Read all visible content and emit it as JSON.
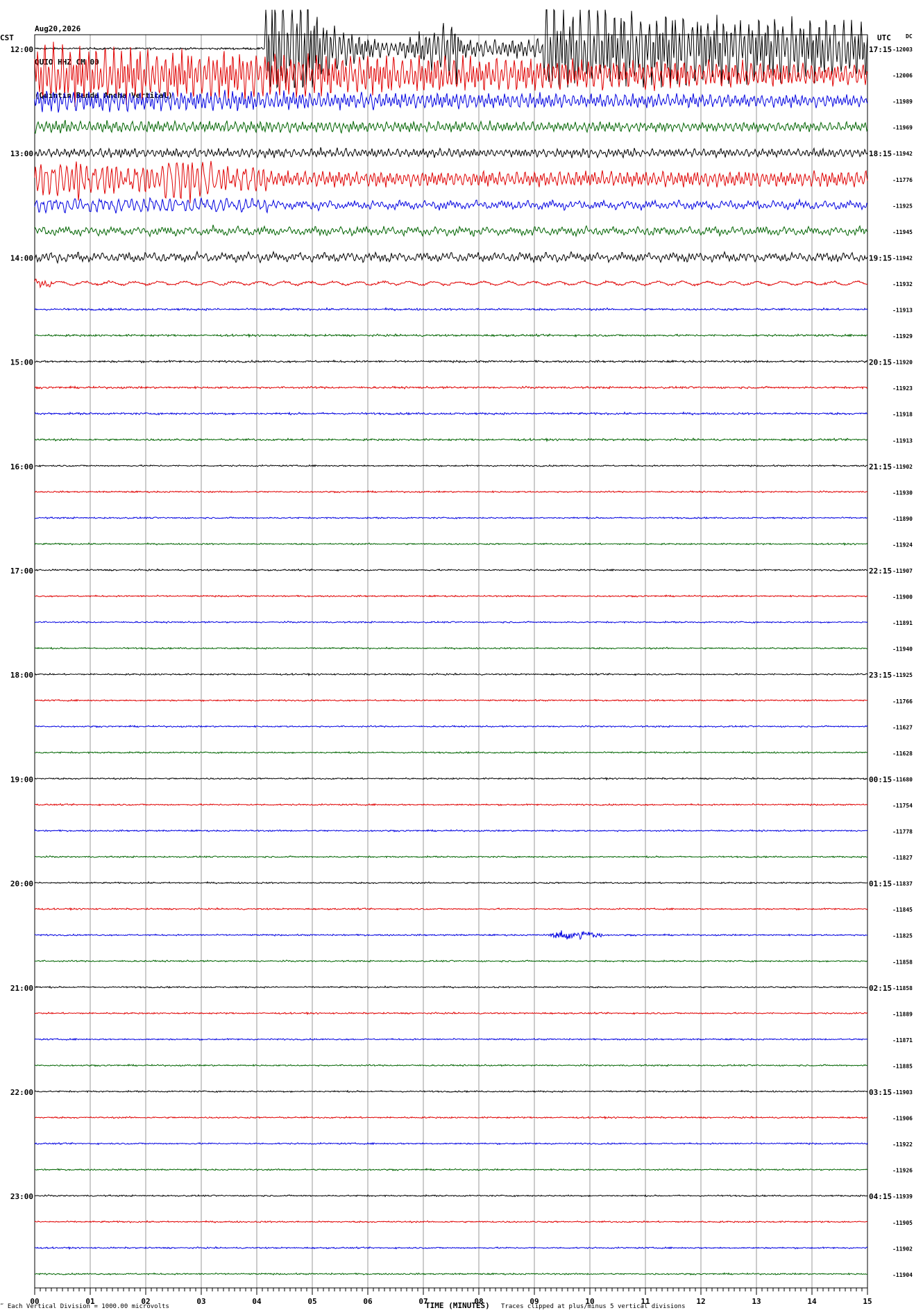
{
  "header": {
    "date": "Aug20,2026",
    "station": "QUIO HHZ CM 00",
    "description": "(Quintin Banda Ancha Vertical)"
  },
  "labels": {
    "left_timezone": "CST",
    "right_timezone": "UTC",
    "dc_header": "DC"
  },
  "footer": {
    "scale_note": "Each Vertical Division = 1000.00 microvolts",
    "x_title": "TIME (MINUTES)",
    "clip_note": "Traces clipped at plus/minus 5 vertical divisions"
  },
  "colors": {
    "cycle": [
      "#000000",
      "#e00000",
      "#0000e0",
      "#006400"
    ],
    "grid": "#9a9a9a",
    "frame": "#000000"
  },
  "chart_data": {
    "type": "line",
    "title": "",
    "xlabel": "TIME (MINUTES)",
    "ylabel": "",
    "xlim": [
      0,
      15
    ],
    "x_ticks": [
      "00",
      "01",
      "02",
      "03",
      "04",
      "05",
      "06",
      "07",
      "08",
      "09",
      "10",
      "11",
      "12",
      "13",
      "14",
      "15"
    ],
    "grid": true,
    "trace_minutes": 15,
    "left_hour_labels": [
      "12:00",
      "13:00",
      "14:00",
      "15:00",
      "16:00",
      "17:00",
      "18:00",
      "19:00",
      "20:00",
      "21:00",
      "22:00",
      "23:00"
    ],
    "right_hour_labels": [
      "17:15",
      "18:15",
      "19:15",
      "20:15",
      "21:15",
      "22:15",
      "23:15",
      "00:15",
      "01:15",
      "02:15",
      "03:15",
      "04:15"
    ],
    "traces": [
      {
        "start_cst": "12:00",
        "dc": "-12003"
      },
      {
        "start_cst": "12:15",
        "dc": "-12006"
      },
      {
        "start_cst": "12:30",
        "dc": "-11989"
      },
      {
        "start_cst": "12:45",
        "dc": "-11969"
      },
      {
        "start_cst": "13:00",
        "dc": "-11942"
      },
      {
        "start_cst": "13:15",
        "dc": "-11776"
      },
      {
        "start_cst": "13:30",
        "dc": "-11925"
      },
      {
        "start_cst": "13:45",
        "dc": "-11945"
      },
      {
        "start_cst": "14:00",
        "dc": "-11942"
      },
      {
        "start_cst": "14:15",
        "dc": "-11932"
      },
      {
        "start_cst": "14:30",
        "dc": "-11913"
      },
      {
        "start_cst": "14:45",
        "dc": "-11929"
      },
      {
        "start_cst": "15:00",
        "dc": "-11920"
      },
      {
        "start_cst": "15:15",
        "dc": "-11923"
      },
      {
        "start_cst": "15:30",
        "dc": "-11918"
      },
      {
        "start_cst": "15:45",
        "dc": "-11913"
      },
      {
        "start_cst": "16:00",
        "dc": "-11902"
      },
      {
        "start_cst": "16:15",
        "dc": "-11930"
      },
      {
        "start_cst": "16:30",
        "dc": "-11890"
      },
      {
        "start_cst": "16:45",
        "dc": "-11924"
      },
      {
        "start_cst": "17:00",
        "dc": "-11907"
      },
      {
        "start_cst": "17:15",
        "dc": "-11900"
      },
      {
        "start_cst": "17:30",
        "dc": "-11891"
      },
      {
        "start_cst": "17:45",
        "dc": "-11940"
      },
      {
        "start_cst": "18:00",
        "dc": "-11925"
      },
      {
        "start_cst": "18:15",
        "dc": "-11766"
      },
      {
        "start_cst": "18:30",
        "dc": "-11627"
      },
      {
        "start_cst": "18:45",
        "dc": "-11628"
      },
      {
        "start_cst": "19:00",
        "dc": "-11680"
      },
      {
        "start_cst": "19:15",
        "dc": "-11754"
      },
      {
        "start_cst": "19:30",
        "dc": "-11778"
      },
      {
        "start_cst": "19:45",
        "dc": "-11827"
      },
      {
        "start_cst": "20:00",
        "dc": "-11837"
      },
      {
        "start_cst": "20:15",
        "dc": "-11845"
      },
      {
        "start_cst": "20:30",
        "dc": "-11825"
      },
      {
        "start_cst": "20:45",
        "dc": "-11858"
      },
      {
        "start_cst": "21:00",
        "dc": "-11858"
      },
      {
        "start_cst": "21:15",
        "dc": "-11889"
      },
      {
        "start_cst": "21:30",
        "dc": "-11871"
      },
      {
        "start_cst": "21:45",
        "dc": "-11885"
      },
      {
        "start_cst": "22:00",
        "dc": "-11903"
      },
      {
        "start_cst": "22:15",
        "dc": "-11906"
      },
      {
        "start_cst": "22:30",
        "dc": "-11922"
      },
      {
        "start_cst": "22:45",
        "dc": "-11926"
      },
      {
        "start_cst": "23:00",
        "dc": "-11939"
      },
      {
        "start_cst": "23:15",
        "dc": "-11905"
      },
      {
        "start_cst": "23:30",
        "dc": "-11902"
      },
      {
        "start_cst": "23:45",
        "dc": "-11904"
      }
    ],
    "events": [
      {
        "name": "earthquake",
        "start_trace": 0,
        "start_minute": 4.15,
        "end_trace": 9,
        "end_minute": 0.3
      }
    ]
  }
}
